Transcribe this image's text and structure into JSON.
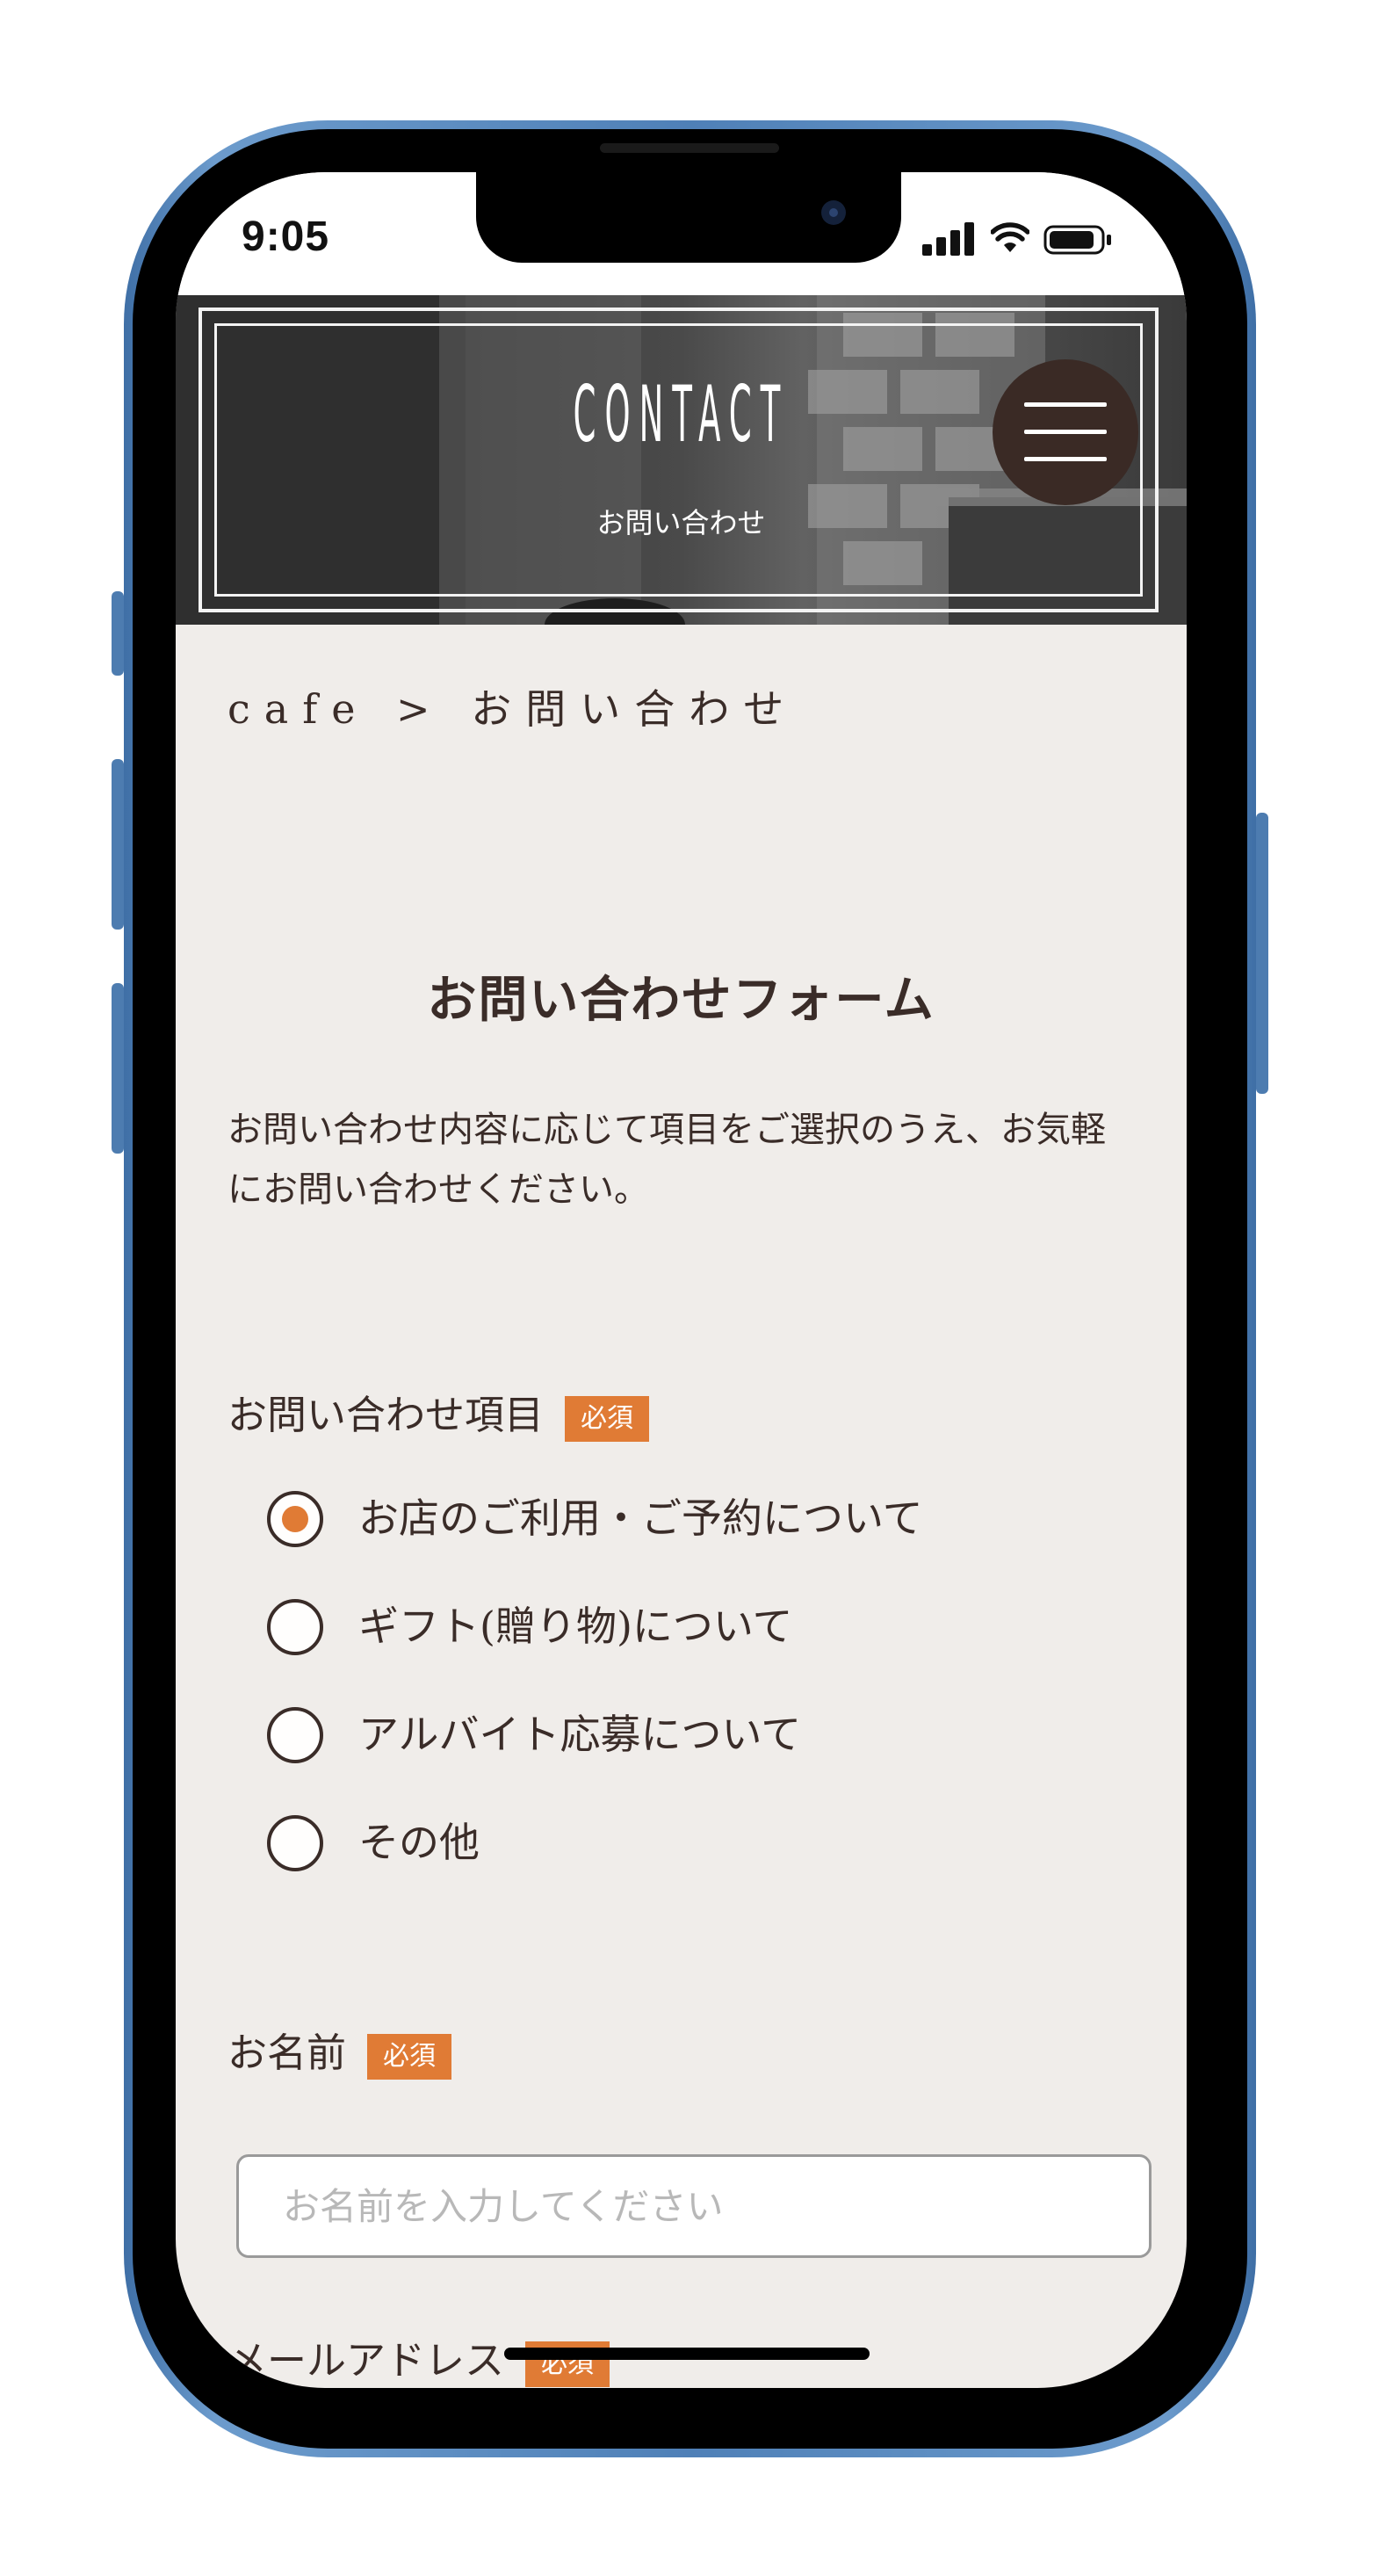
{
  "status_bar": {
    "time": "9:05"
  },
  "hero": {
    "title": "CONTACT",
    "subtitle": "お問い合わせ",
    "menu_icon": "hamburger-menu-icon"
  },
  "breadcrumb": "cafe > お問い合わせ",
  "form": {
    "title": "お問い合わせフォーム",
    "intro": "お問い合わせ内容に応じて項目をご選択のうえ、お気軽にお問い合わせください。",
    "required_label": "必須",
    "inquiry_type": {
      "label": "お問い合わせ項目",
      "options": [
        {
          "label": "お店のご利用・ご予約について",
          "selected": true
        },
        {
          "label": "ギフト(贈り物)について",
          "selected": false
        },
        {
          "label": "アルバイト応募について",
          "selected": false
        },
        {
          "label": "その他",
          "selected": false
        }
      ]
    },
    "name": {
      "label": "お名前",
      "value": "",
      "placeholder": "お名前を入力してください"
    },
    "email": {
      "label": "メールアドレス"
    }
  },
  "colors": {
    "accent": "#e07b35",
    "text": "#3a2c28",
    "page_bg": "#f0edea",
    "menu_button_bg": "#3a2a25",
    "device_frame": "#4f80b7"
  }
}
